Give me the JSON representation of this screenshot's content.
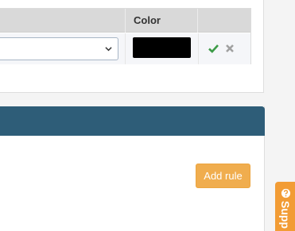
{
  "rules_table": {
    "headers": [
      "",
      "Color",
      ""
    ],
    "rows": [
      {
        "field_select_value": "",
        "color_hex": "#000000"
      }
    ]
  },
  "actions": {
    "add_rule_label": "Add rule"
  },
  "support_tab": {
    "label": "Supp"
  },
  "colors": {
    "panel_header": "#2e5d78",
    "add_rule_button": "#f0ad4e",
    "support_tab": "#f29c35",
    "confirm_icon": "#3c9b47",
    "delete_icon": "#a0a0a0"
  }
}
